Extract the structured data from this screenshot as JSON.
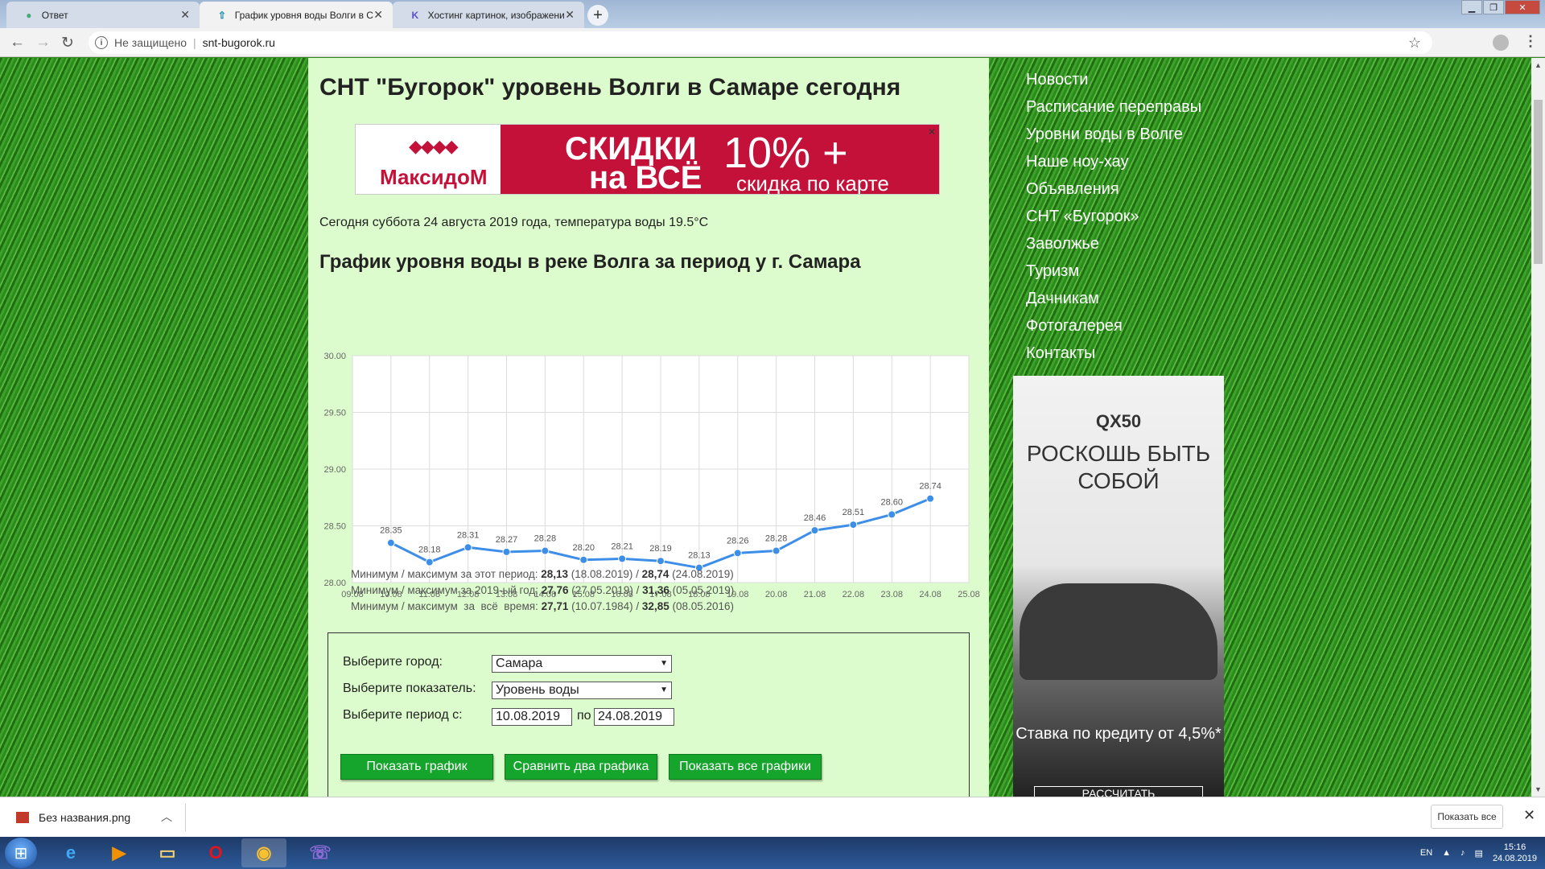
{
  "browser": {
    "tabs": [
      {
        "label": "Ответ",
        "icon": "globe-icon",
        "active": false
      },
      {
        "label": "График уровня воды Волги в Са",
        "icon": "arrow-up-icon",
        "active": true
      },
      {
        "label": "Хостинг картинок, изображени",
        "icon": "k-logo-icon",
        "active": false
      }
    ],
    "close_glyph": "✕",
    "new_tab_glyph": "+",
    "security_label": "Не защищено",
    "url": "snt-bugorok.ru"
  },
  "page": {
    "title": "СНТ \"Бугорок\" уровень Волги в Самаре сегодня",
    "banner": {
      "brand": "МаксидоМ",
      "line1": "СКИДКИ",
      "line2": "на ВСЁ",
      "big": "10% +",
      "sub": "скидка по карте",
      "close": "✕"
    },
    "today": "Сегодня суббота 24 августа 2019 года, температура воды 19.5°C",
    "chart_title": "График уровня воды в реке Волга за период у г. Самара",
    "stats": [
      {
        "label": "Минимум / максимум за этот период: ",
        "min": "28,13",
        "min_date": " (18.08.2019) / ",
        "max": "28,74",
        "max_date": " (24.08.2019)"
      },
      {
        "label": "Минимум / максимум за 2019-ый год: ",
        "min": "27,76",
        "min_date": " (27.05.2019) / ",
        "max": "31,36",
        "max_date": " (05.05.2019)"
      },
      {
        "label": "Минимум / максимум  за  всё  время: ",
        "min": "27,71",
        "min_date": " (10.07.1984) / ",
        "max": "32,85",
        "max_date": " (08.05.2016)"
      }
    ],
    "form": {
      "city_label": "Выберите город:",
      "city_value": "Самара",
      "metric_label": "Выберите показатель:",
      "metric_value": "Уровень воды",
      "period_label": "Выберите период с:",
      "date_from": "10.08.2019",
      "po_label": "по",
      "date_to": "24.08.2019",
      "btn_show": "Показать график",
      "btn_compare": "Сравнить два графика",
      "btn_all": "Показать все графики"
    }
  },
  "sidebar": {
    "items": [
      "Новости",
      "Расписание переправы",
      "Уровни воды в Волге",
      "Наше ноу-хау",
      "Объявления",
      "СНТ «Бугорок»",
      "Заволжье",
      "Туризм",
      "Дачникам",
      "Фотогалерея",
      "Контакты"
    ]
  },
  "ad": {
    "brand": "QX50",
    "slogan": "РОСКОШЬ БЫТЬ СОБОЙ",
    "credit": "Ставка по кредиту от 4,5%*",
    "cta": "РАССЧИТАТЬ"
  },
  "downloads": {
    "file": "Без названия.png",
    "show_all": "Показать все"
  },
  "taskbar": {
    "lang": "EN",
    "time": "15:16",
    "date": "24.08.2019"
  },
  "chart_data": {
    "type": "line",
    "x": [
      "09.08",
      "10.08",
      "11.08",
      "12.08",
      "13.08",
      "14.08",
      "15.08",
      "16.08",
      "17.08",
      "18.08",
      "19.08",
      "20.08",
      "21.08",
      "22.08",
      "23.08",
      "24.08",
      "25.08"
    ],
    "series": [
      {
        "values": [
          null,
          28.35,
          28.18,
          28.31,
          28.27,
          28.28,
          28.2,
          28.21,
          28.19,
          28.13,
          28.26,
          28.28,
          28.46,
          28.51,
          28.6,
          28.74,
          null
        ],
        "labels": [
          null,
          "28.35",
          "28.18",
          "28.31",
          "28.27",
          "28.28",
          "28.20",
          "28.21",
          "28.19",
          "28.13",
          "28.26",
          "28.28",
          "28.46",
          "28.51",
          "28.60",
          "28.74",
          null
        ],
        "color": "#3d8ee8"
      }
    ],
    "y_ticks": [
      "28.00",
      "28.50",
      "29.00",
      "29.50",
      "30.00"
    ],
    "ylim": [
      28.0,
      30.0
    ],
    "grid": true,
    "title": "",
    "xlabel": "",
    "ylabel": ""
  }
}
